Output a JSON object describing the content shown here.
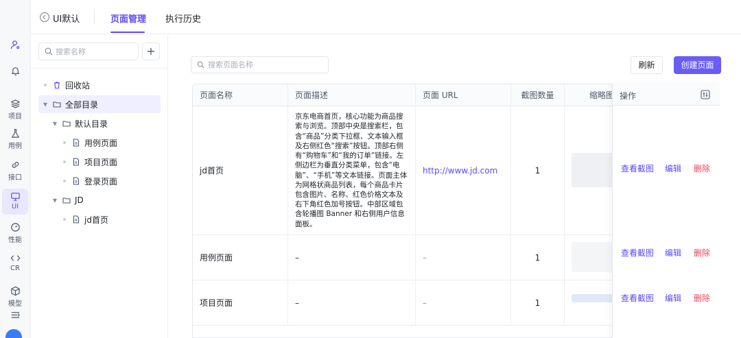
{
  "rail": {
    "items": [
      {
        "icon": "user-settings-icon",
        "label": ""
      },
      {
        "icon": "bell-icon",
        "label": ""
      },
      {
        "icon": "layers-icon",
        "label": "项目"
      },
      {
        "icon": "flask-icon",
        "label": "用例"
      },
      {
        "icon": "link-icon",
        "label": "接口"
      },
      {
        "icon": "monitor-icon",
        "label": "UI"
      },
      {
        "icon": "gauge-icon",
        "label": "性能"
      },
      {
        "icon": "code-icon",
        "label": "CR"
      },
      {
        "icon": "cube-icon",
        "label": "模型"
      },
      {
        "icon": "menu-collapse-icon",
        "label": ""
      }
    ]
  },
  "topbar": {
    "app_name": "UI默认",
    "tabs": [
      {
        "label": "页面管理",
        "active": true
      },
      {
        "label": "执行历史",
        "active": false
      }
    ]
  },
  "tree": {
    "search_placeholder": "搜索名称",
    "nodes": [
      {
        "label": "回收站",
        "icon": "trash-icon"
      },
      {
        "label": "全部目录",
        "icon": "folder-icon"
      },
      {
        "label": "默认目录",
        "icon": "folder-icon"
      },
      {
        "label": "用例页面",
        "icon": "file-icon"
      },
      {
        "label": "项目页面",
        "icon": "file-icon"
      },
      {
        "label": "登录页面",
        "icon": "file-icon"
      },
      {
        "label": "JD",
        "icon": "folder-icon"
      },
      {
        "label": "jd首页",
        "icon": "file-icon"
      }
    ]
  },
  "main": {
    "search_placeholder": "搜索页面名称",
    "refresh_label": "刷新",
    "create_label": "创建页面",
    "columns": [
      "页面名称",
      "页面描述",
      "页面 URL",
      "截图数量",
      "缩略图"
    ],
    "ops_title": "操作",
    "ops": {
      "view": "查看截图",
      "edit": "编辑",
      "delete": "删除"
    },
    "rows": [
      {
        "name": "jd首页",
        "desc": "京东电商首页，核心功能为商品搜索与浏览。顶部中央是搜索栏，包含“商品”分类下拉框、文本输入框及右侧红色“搜索”按钮。顶部右侧有“购物车”和“我的订单”链接。左侧边栏为垂直分类菜单，包含“电脑”、“手机”等文本链接。页面主体为网格状商品列表，每个商品卡片包含图片、名称、红色价格文本及右下角红色加号按钮。中部区域包含轮播图 Banner 和右侧用户信息面板。",
        "url": "http://www.jd.com",
        "count": "1"
      },
      {
        "name": "用例页面",
        "desc": "–",
        "url": "–",
        "count": "1"
      },
      {
        "name": "项目页面",
        "desc": "–",
        "url": "–",
        "count": "1"
      }
    ]
  },
  "colors": {
    "accent": "#6b5cf6",
    "danger": "#f0445a"
  }
}
